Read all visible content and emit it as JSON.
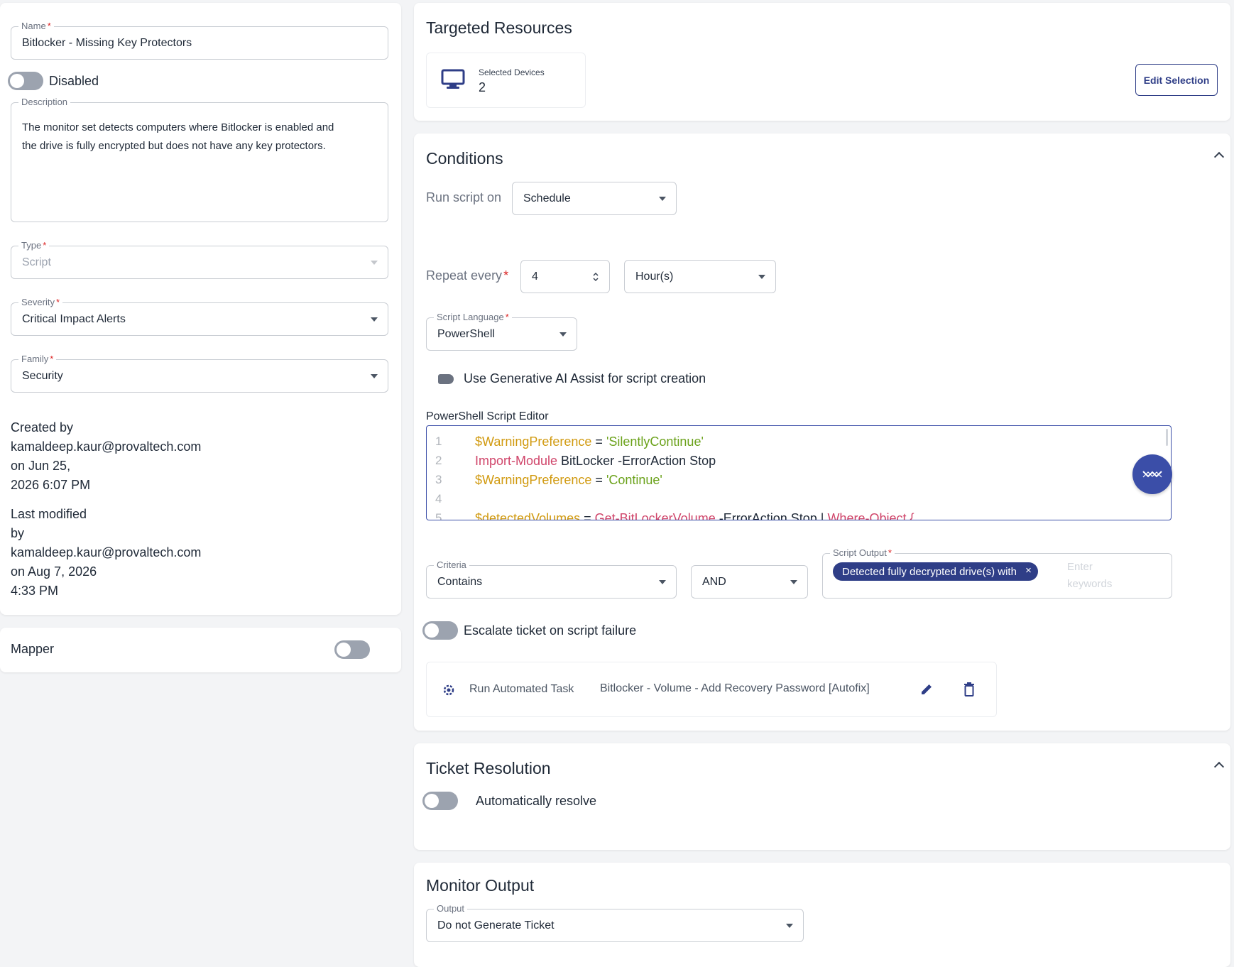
{
  "left_panel": {
    "name_field": {
      "label": "Name",
      "value": "Bitlocker - Missing Key Protectors"
    },
    "status_toggle": {
      "label": "Disabled"
    },
    "description_field": {
      "label": "Description",
      "line1": "The monitor set detects computers where Bitlocker is enabled and",
      "line2": "the drive is fully encrypted but does not have any key protectors."
    },
    "type_field": {
      "label": "Type",
      "value": "Script"
    },
    "severity_field": {
      "label": "Severity",
      "value": "Critical Impact Alerts"
    },
    "family_field": {
      "label": "Family",
      "value": "Security"
    },
    "created": {
      "line1": "Created by",
      "line2": "kamaldeep.kaur@provaltech.com",
      "line3": "on Jun 25,",
      "line4": "2026 6:07 PM"
    },
    "modified": {
      "line1": "Last modified",
      "line2": "by",
      "line3": "kamaldeep.kaur@provaltech.com",
      "line4": "on Aug 7, 2026",
      "line5": "4:33 PM"
    },
    "mapper": {
      "label": "Mapper"
    }
  },
  "targeted_resources": {
    "title": "Targeted Resources",
    "selected_devices_label": "Selected Devices",
    "selected_devices_count": "2",
    "edit_button": "Edit Selection",
    "icon": "monitor-icon"
  },
  "conditions": {
    "title": "Conditions",
    "run_script_label": "Run script on",
    "run_script_value": "Schedule",
    "repeat_label": "Repeat every",
    "repeat_value": "4",
    "repeat_unit": "Hour(s)",
    "script_language_label": "Script Language",
    "script_language_value": "PowerShell",
    "ai_assist_label": "Use Generative AI Assist for script creation",
    "editor_label": "PowerShell Script Editor",
    "code": {
      "l1_num": "1",
      "l1_var": "$WarningPreference",
      "l1_eq": " = ",
      "l1_str": "'SilentlyContinue'",
      "l2_num": "2",
      "l2_cmd": "Import-Module",
      "l2_rest": " BitLocker -ErrorAction Stop",
      "l3_num": "3",
      "l3_var": "$WarningPreference",
      "l3_eq": " = ",
      "l3_str": "'Continue'",
      "l4_num": "4",
      "l5_num": "5",
      "l5_var": "$detectedVolumes",
      "l5_eq": " = ",
      "l5_cmd": "Get-BitLockerVolume",
      "l5_rest": " -ErrorAction Stop | ",
      "l5_cmd2": "Where-Object {"
    },
    "criteria_label": "Criteria",
    "criteria_value": "Contains",
    "operator_value": "AND",
    "script_output_label": "Script Output",
    "script_output_chip": "Detected fully decrypted drive(s) with",
    "script_output_placeholder_1": "Enter",
    "script_output_placeholder_2": "keywords",
    "escalate_label": "Escalate ticket on script failure",
    "task_label": "Run Automated Task",
    "task_value": "Bitlocker - Volume - Add Recovery Password [Autofix]"
  },
  "ticket_resolution": {
    "title": "Ticket Resolution",
    "auto_resolve_label": "Automatically resolve"
  },
  "monitor_output": {
    "title": "Monitor Output",
    "output_label": "Output",
    "output_value": "Do not Generate Ticket"
  },
  "colors": {
    "accent": "#3b4ea8",
    "chip": "#2f3e87",
    "required": "#dc2626"
  }
}
